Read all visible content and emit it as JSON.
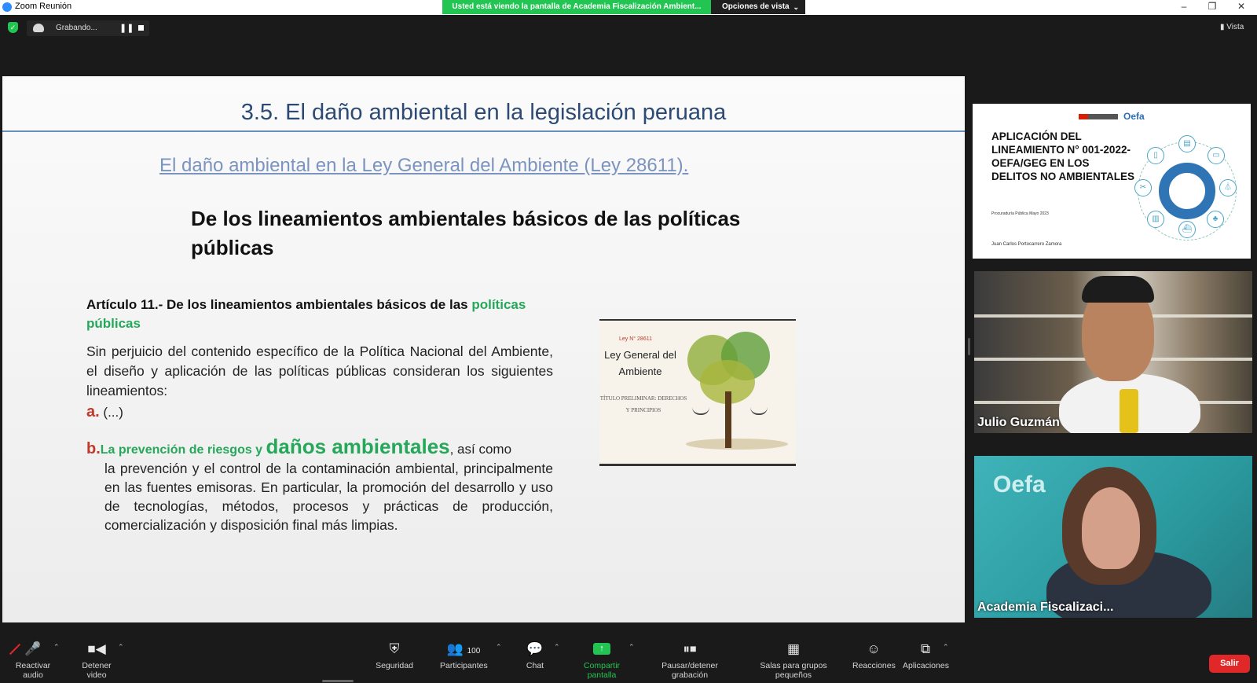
{
  "window": {
    "title": "Zoom Reunión",
    "share_banner": "Usted está viendo la pantalla de Academia Fiscalización Ambient...",
    "view_options": "Opciones de vista",
    "recording_label": "Grabando...",
    "view_button": "Vista"
  },
  "slide": {
    "title": "3.5. El daño ambiental en la legislación peruana",
    "subtitle": "El daño ambiental  en la Ley General del Ambiente (Ley 28611).",
    "heading": "De los lineamientos ambientales básicos de las políticas públicas",
    "article_title_prefix": "Artículo 11.- De los lineamientos ambientales básicos de las ",
    "article_title_highlight": "políticas públicas",
    "intro": "Sin perjuicio del contenido específico de la Política Nacional del Ambiente, el diseño y aplicación de las políticas públicas consideran los siguientes lineamientos:",
    "item_a_letter": "a.",
    "item_a_text": "(...)",
    "item_b_letter": "b.",
    "item_b_green": "La prevención de riesgos y ",
    "item_b_big": "daños ambientales",
    "item_b_after": ", así como",
    "item_b_body": "la prevención y el control de la contaminación ambiental, principalmente en las fuentes emisoras. En particular, la promoción del desarrollo y uso de tecnologías, métodos, procesos y prácticas de producción, comercialización y disposición final más limpias.",
    "book": {
      "law_number": "Ley N° 28611",
      "title": "Ley General del Ambiente",
      "subtitle": "TÍTULO PRELIMINAR: DERECHOS Y PRINCIPIOS"
    }
  },
  "thumbnail": {
    "brand": "Oefa",
    "deck_title": "APLICACIÓN DEL LINEAMIENTO N° 001-2022-OEFA/GEG EN LOS DELITOS NO AMBIENTALES",
    "org": "Procuraduría Pública Mayo 2023",
    "author": "Juan Carlos Portocarrero Zamora"
  },
  "participants": [
    {
      "name": "Julio Guzmán"
    },
    {
      "name": "Academia Fiscalizaci..."
    }
  ],
  "toolbar": {
    "unmute": "Reactivar audio",
    "stop_video": "Detener video",
    "security": "Seguridad",
    "participants": "Participantes",
    "participant_count": "100",
    "chat": "Chat",
    "share_screen": "Compartir pantalla",
    "pause_recording": "Pausar/detener grabación",
    "breakout_rooms": "Salas para grupos pequeños",
    "reactions": "Reacciones",
    "apps": "Aplicaciones",
    "leave": "Salir"
  },
  "colors": {
    "share_banner": "#23c552",
    "leave": "#e02828",
    "slide_title": "#2c4a73",
    "highlight_green": "#25a85a"
  }
}
